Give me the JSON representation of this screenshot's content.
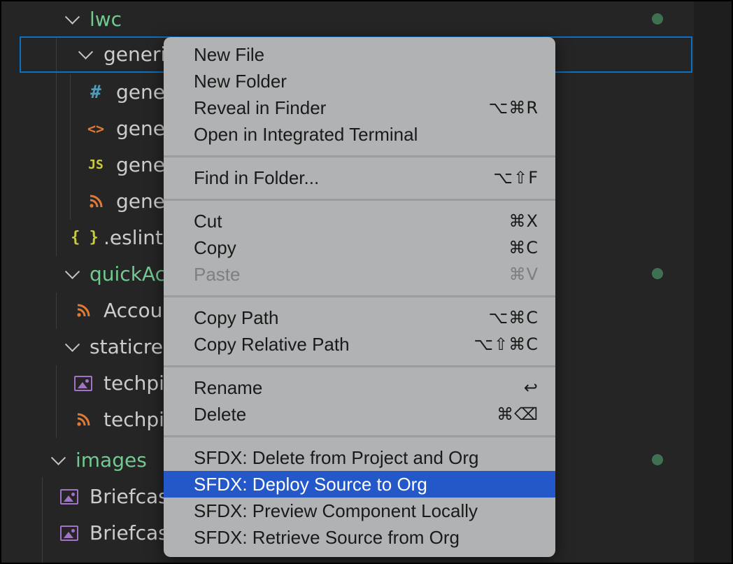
{
  "tree": {
    "rows": [
      {
        "label": "lwc",
        "icon": "chevron-down"
      },
      {
        "label": "generi",
        "icon": "chevron-down"
      },
      {
        "label": "gene",
        "icon": "#"
      },
      {
        "label": "gene",
        "icon": "<>"
      },
      {
        "label": "gene",
        "icon": "JS"
      },
      {
        "label": "gene",
        "icon": "rss-icon"
      },
      {
        "label": ".eslintı",
        "icon": "{ }"
      },
      {
        "label": "quickAc",
        "icon": "chevron-down"
      },
      {
        "label": "Accou",
        "icon": "rss-icon"
      },
      {
        "label": "staticre",
        "icon": "chevron-down"
      },
      {
        "label": "techpi",
        "icon": "image-icon"
      },
      {
        "label": "techpi",
        "icon": "rss-icon"
      },
      {
        "label": "images",
        "icon": "chevron-down"
      },
      {
        "label": "Briefcas",
        "icon": "image-icon"
      },
      {
        "label": "Briefcas",
        "icon": "image-icon"
      }
    ]
  },
  "menu": {
    "items": [
      {
        "label": "New File",
        "shortcut": ""
      },
      {
        "label": "New Folder",
        "shortcut": ""
      },
      {
        "label": "Reveal in Finder",
        "shortcut": "⌥⌘R"
      },
      {
        "label": "Open in Integrated Terminal",
        "shortcut": ""
      },
      {
        "label": "Find in Folder...",
        "shortcut": "⌥⇧F"
      },
      {
        "label": "Cut",
        "shortcut": "⌘X"
      },
      {
        "label": "Copy",
        "shortcut": "⌘C"
      },
      {
        "label": "Paste",
        "shortcut": "⌘V"
      },
      {
        "label": "Copy Path",
        "shortcut": "⌥⌘C"
      },
      {
        "label": "Copy Relative Path",
        "shortcut": "⌥⇧⌘C"
      },
      {
        "label": "Rename",
        "shortcut": "↩"
      },
      {
        "label": "Delete",
        "shortcut": "⌘⌫"
      },
      {
        "label": "SFDX: Delete from Project and Org",
        "shortcut": ""
      },
      {
        "label": "SFDX: Deploy Source to Org",
        "shortcut": ""
      },
      {
        "label": "SFDX: Preview Component Locally",
        "shortcut": ""
      },
      {
        "label": "SFDX: Retrieve Source from Org",
        "shortcut": ""
      }
    ]
  },
  "colors": {
    "folder_green": "#73c991",
    "selection_border": "#0e70c0",
    "menu_highlight": "#2458c8"
  }
}
